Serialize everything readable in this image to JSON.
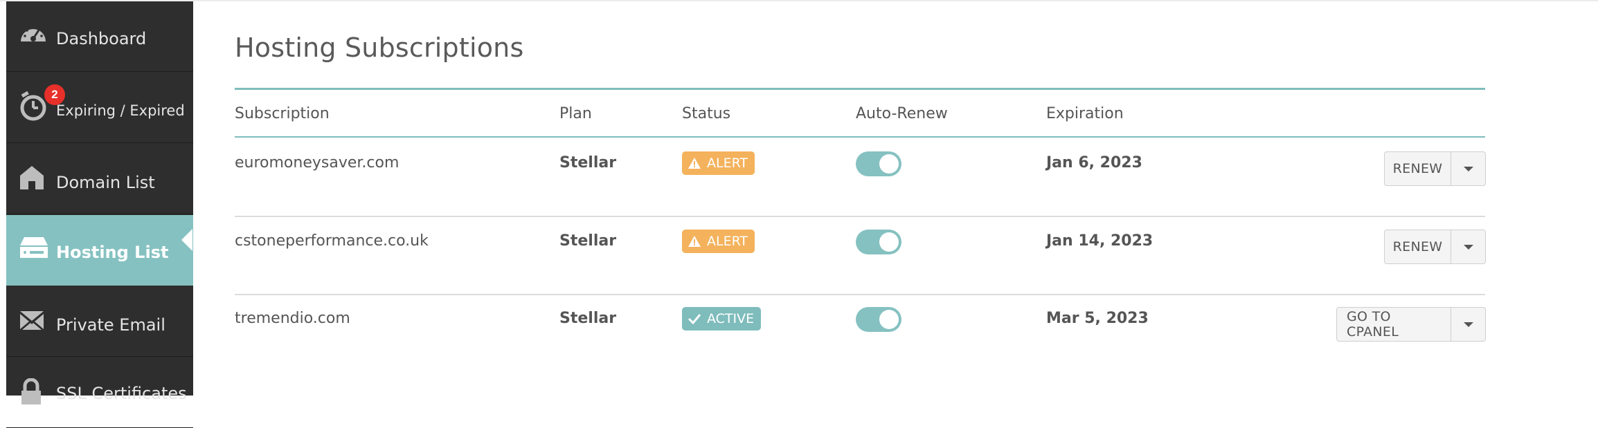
{
  "sidebar": {
    "items": [
      {
        "label": "Dashboard",
        "icon": "speedometer-icon"
      },
      {
        "label": "Expiring / Expired",
        "icon": "stopwatch-icon",
        "badge": "2"
      },
      {
        "label": "Domain List",
        "icon": "house-icon"
      },
      {
        "label": "Hosting List",
        "icon": "server-icon",
        "active": true
      },
      {
        "label": "Private Email",
        "icon": "envelope-icon"
      },
      {
        "label": "SSL Certificates",
        "icon": "lock-icon"
      }
    ]
  },
  "main": {
    "title": "Hosting Subscriptions",
    "columns": {
      "subscription": "Subscription",
      "plan": "Plan",
      "status": "Status",
      "auto_renew": "Auto-Renew",
      "expiration": "Expiration"
    },
    "rows": [
      {
        "subscription": "euromoneysaver.com",
        "plan": "Stellar",
        "status": "ALERT",
        "auto_renew": true,
        "expiration": "Jan 6, 2023",
        "action": "RENEW"
      },
      {
        "subscription": "cstoneperformance.co.uk",
        "plan": "Stellar",
        "status": "ALERT",
        "auto_renew": true,
        "expiration": "Jan 14, 2023",
        "action": "RENEW"
      },
      {
        "subscription": "tremendio.com",
        "plan": "Stellar",
        "status": "ACTIVE",
        "auto_renew": true,
        "expiration": "Mar 5, 2023",
        "action": "GO TO CPANEL"
      }
    ]
  },
  "colors": {
    "sidebar_bg": "#2e2e2e",
    "accent_teal": "#86c1c1",
    "alert_orange": "#f4b25c",
    "badge_red": "#e8302a"
  }
}
